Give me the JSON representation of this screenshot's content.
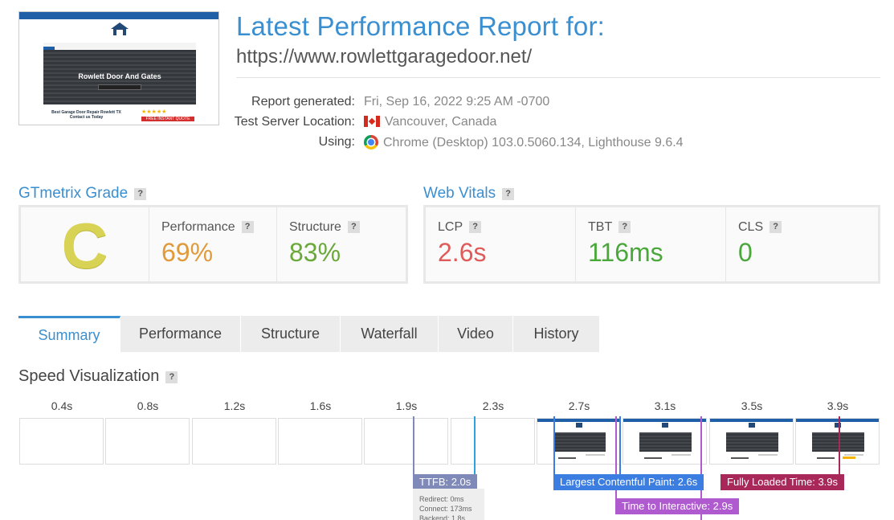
{
  "thumbnail": {
    "hero_title": "Rowlett Door And Gates",
    "footer_text": "Best Garage Door Repair Rowlett TX Contact us Today",
    "quote_text": "FREE INSTANT QUOTE"
  },
  "header": {
    "title": "Latest Performance Report for:",
    "url": "https://www.rowlettgaragedoor.net/"
  },
  "meta": {
    "report_generated_label": "Report generated:",
    "report_generated_value": "Fri, Sep 16, 2022 9:25 AM -0700",
    "server_label": "Test Server Location:",
    "server_value": "Vancouver, Canada",
    "using_label": "Using:",
    "using_value": "Chrome (Desktop) 103.0.5060.134, Lighthouse 9.6.4"
  },
  "grade": {
    "heading": "GTmetrix Grade",
    "help": "?",
    "letter": "C",
    "performance_label": "Performance",
    "performance_value": "69%",
    "structure_label": "Structure",
    "structure_value": "83%"
  },
  "vitals": {
    "heading": "Web Vitals",
    "help": "?",
    "lcp_label": "LCP",
    "lcp_value": "2.6s",
    "tbt_label": "TBT",
    "tbt_value": "116ms",
    "cls_label": "CLS",
    "cls_value": "0"
  },
  "tabs": [
    "Summary",
    "Performance",
    "Structure",
    "Waterfall",
    "Video",
    "History"
  ],
  "speed_viz": {
    "heading": "Speed Visualization",
    "times": [
      "0.4s",
      "0.8s",
      "1.2s",
      "1.6s",
      "1.9s",
      "2.3s",
      "2.7s",
      "3.1s",
      "3.5s",
      "3.9s"
    ],
    "markers": {
      "ttfb": "TTFB: 2.0s",
      "lcp": "Largest Contentful Paint: 2.6s",
      "tti": "Time to Interactive: 2.9s",
      "flt": "Fully Loaded Time: 3.9s"
    },
    "ttfb_details": [
      "Redirect: 0ms",
      "Connect: 173ms",
      "Backend: 1.8s"
    ]
  },
  "colors": {
    "brand": "#3a8fd1",
    "grade_c": "#d8d354",
    "performance": "#e09a3a",
    "structure": "#6aa83a",
    "lcp": "#e05a5a",
    "good": "#4aa83a",
    "ttfb": "#7f8ab8",
    "lcp_marker": "#3b7de0",
    "tti": "#b05ad0",
    "flt": "#a8285a"
  }
}
